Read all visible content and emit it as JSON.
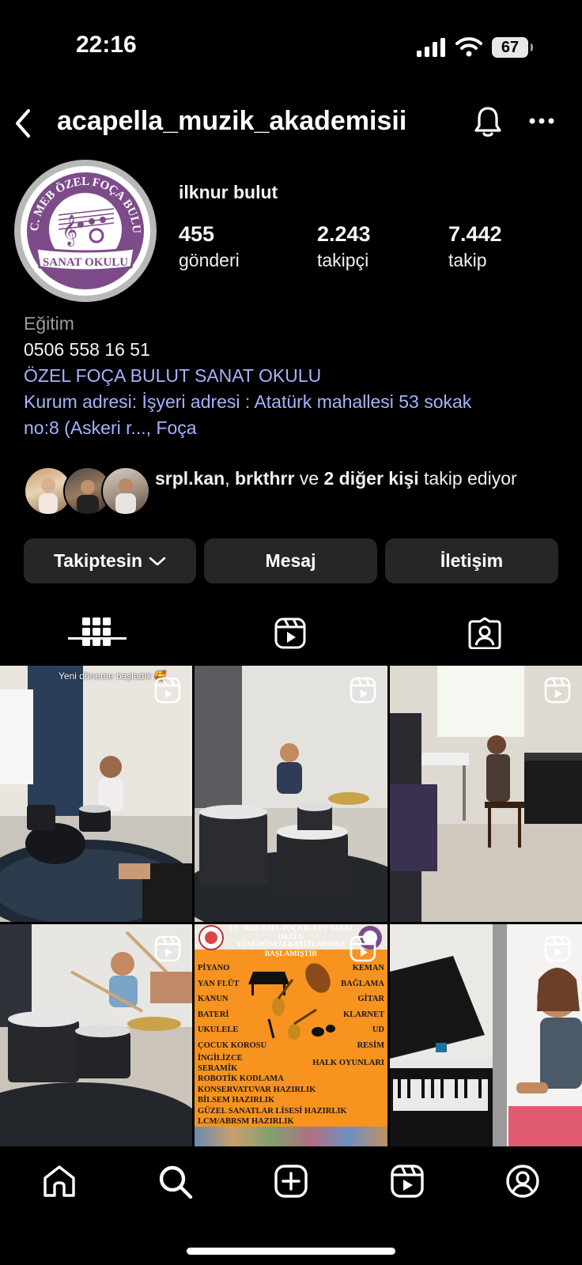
{
  "status_bar": {
    "time": "22:16",
    "battery": "67"
  },
  "header": {
    "username": "acapella_muzik_akademisii"
  },
  "profile": {
    "display_name": "ilknur bulut",
    "avatar_logo_text": "T.C. MEB ÖZEL FOÇA BULUT SANAT OKULU",
    "stats": [
      {
        "value": "455",
        "label": "gönderi"
      },
      {
        "value": "2.243",
        "label": "takipçi"
      },
      {
        "value": "7.442",
        "label": "takip"
      }
    ],
    "category": "Eğitim",
    "phone": "0506 558 16 51",
    "org_link": "ÖZEL FOÇA BULUT SANAT OKULU",
    "address_line1": "Kurum adresi: İşyeri adresi : Atatürk mahallesi 53 sokak",
    "address_line2": "no:8 (Askeri r..., Foça"
  },
  "followed_by": {
    "user1": "srpl.kan",
    "sep": ", ",
    "user2": "brkthrr",
    "and": " ve ",
    "others": "2 diğer kişi",
    "suffix": " takip ediyor"
  },
  "actions": {
    "following": "Takiptesin",
    "message": "Mesaj",
    "contact": "İletişim"
  },
  "posts": {
    "post1_caption": "Yeni döneme başladık 🥰",
    "poster": {
      "title1": "T.C. MEB ÖZEL FOÇA BULUT SANAT",
      "title2": "OKULU",
      "headline1": "YENİ DÖNEM KAYITLARIMIZ",
      "headline2": "BAŞLAMIŞTIR",
      "left_items": [
        "PİYANO",
        "YAN FLÜT",
        "KANUN",
        "BATERİ",
        "UKULELE",
        "ÇOCUK KOROSU",
        "İNGİLİZCE",
        "SERAMİK"
      ],
      "right_items": [
        "KEMAN",
        "BAĞLAMA",
        "GİTAR",
        "KLARNET",
        "UD",
        "RESİM",
        "HALK OYUNLARI"
      ],
      "bottom_items": [
        "ROBOTİK KODLAMA",
        "KONSERVATUVAR HAZIRLIK",
        "BİLSEM HAZIRLIK",
        "GÜZEL SANATLAR LİSESİ HAZIRLIK",
        "LCM/ABRSM HAZIRLIK"
      ]
    }
  },
  "colors": {
    "background": "#000000",
    "button": "#262626",
    "link": "#a5b3ff",
    "poster_orange": "#f7931e",
    "logo_purple": "#7d4b8a"
  }
}
